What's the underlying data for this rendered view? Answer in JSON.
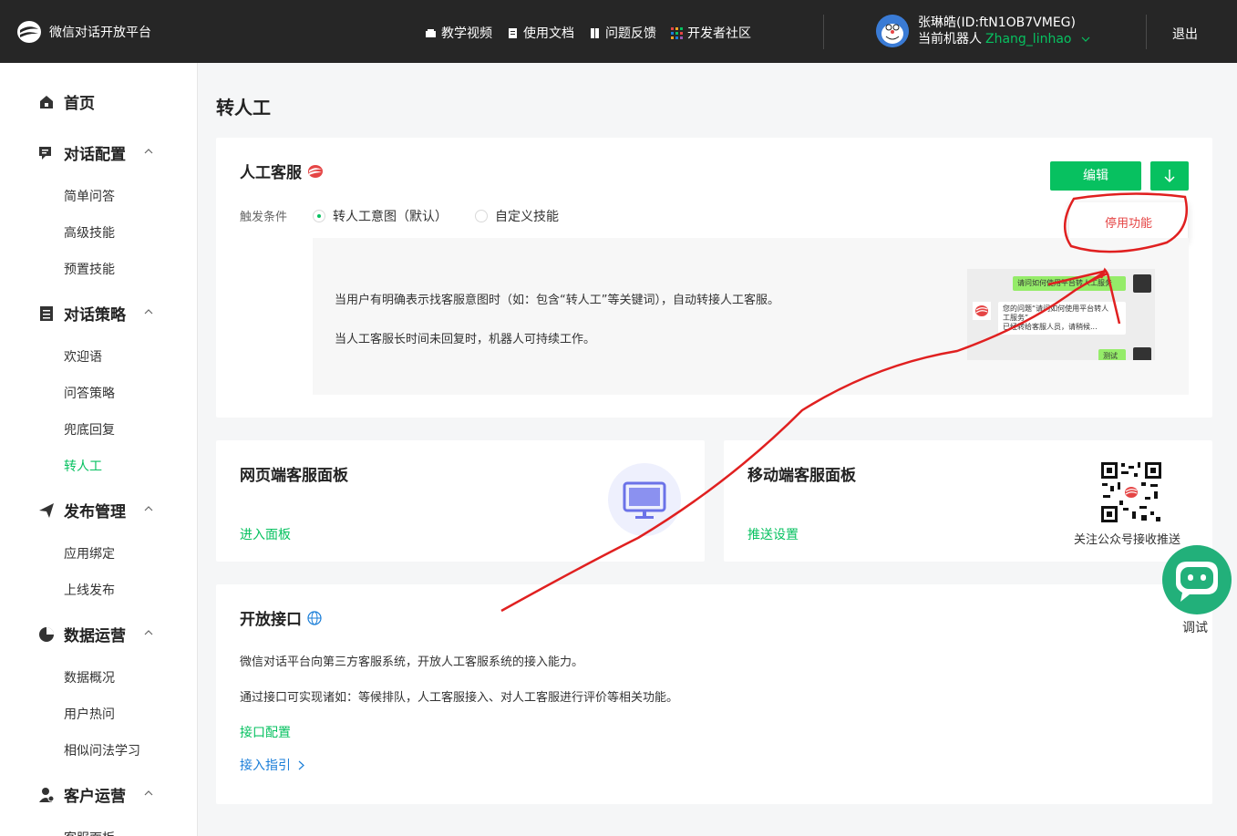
{
  "header": {
    "brand": "微信对话开放平台",
    "nav": [
      {
        "label": "教学视频",
        "icon": "video-icon"
      },
      {
        "label": "使用文档",
        "icon": "document-icon"
      },
      {
        "label": "问题反馈",
        "icon": "feedback-icon"
      },
      {
        "label": "开发者社区",
        "icon": "community-icon"
      }
    ],
    "user_name": "张琳皓(ID:ftN1OB7VMEG)",
    "current_bot_label": "当前机器人",
    "current_bot": "Zhang_linhao",
    "logout": "退出"
  },
  "sidebar": {
    "home": "首页",
    "groups": [
      {
        "label": "对话配置",
        "icon": "chat-config-icon",
        "items": [
          "简单问答",
          "高级技能",
          "预置技能"
        ]
      },
      {
        "label": "对话策略",
        "icon": "strategy-icon",
        "items": [
          "欢迎语",
          "问答策略",
          "兜底回复",
          "转人工"
        ]
      },
      {
        "label": "发布管理",
        "icon": "publish-icon",
        "items": [
          "应用绑定",
          "上线发布"
        ]
      },
      {
        "label": "数据运营",
        "icon": "data-icon",
        "items": [
          "数据概况",
          "用户热问",
          "相似问法学习"
        ]
      },
      {
        "label": "客户运营",
        "icon": "customer-icon",
        "items": [
          "客服面板"
        ]
      }
    ],
    "active_item": "转人工"
  },
  "main": {
    "title": "转人工",
    "human_service": {
      "title": "人工客服",
      "edit_button": "编辑",
      "dropdown_item": "停用功能",
      "trigger_label": "触发条件",
      "option_default": "转人工意图（默认）",
      "option_custom": "自定义技能",
      "desc_line1": "当用户有明确表示找客服意图时（如：包含“转人工”等关键词），自动转接人工客服。",
      "desc_line2": "当人工客服长时间未回复时，机器人可持续工作。",
      "preview": {
        "user_msg": "请问如何使用平台转人工服务",
        "bot_msg_line1": "您的问题“请问如何使用平台转人",
        "bot_msg_line2": "工服务”",
        "bot_msg_line3": "已经转给客服人员，请稍候...",
        "test_msg": "测试"
      }
    },
    "web_panel": {
      "title": "网页端客服面板",
      "link": "进入面板"
    },
    "mobile_panel": {
      "title": "移动端客服面板",
      "link": "推送设置",
      "qr_caption": "关注公众号接收推送"
    },
    "open_api": {
      "title": "开放接口",
      "line1": "微信对话平台向第三方客服系统，开放人工客服系统的接入能力。",
      "line2": "通过接口可实现诸如：等候排队，人工客服接入、对人工客服进行评价等相关功能。",
      "config_link": "接口配置",
      "guide_link": "接入指引"
    },
    "debug": "调试"
  },
  "colors": {
    "accent": "#07c160",
    "topbar": "#262626",
    "link_blue": "#1a7ed8",
    "annotation_red": "#e02020"
  }
}
